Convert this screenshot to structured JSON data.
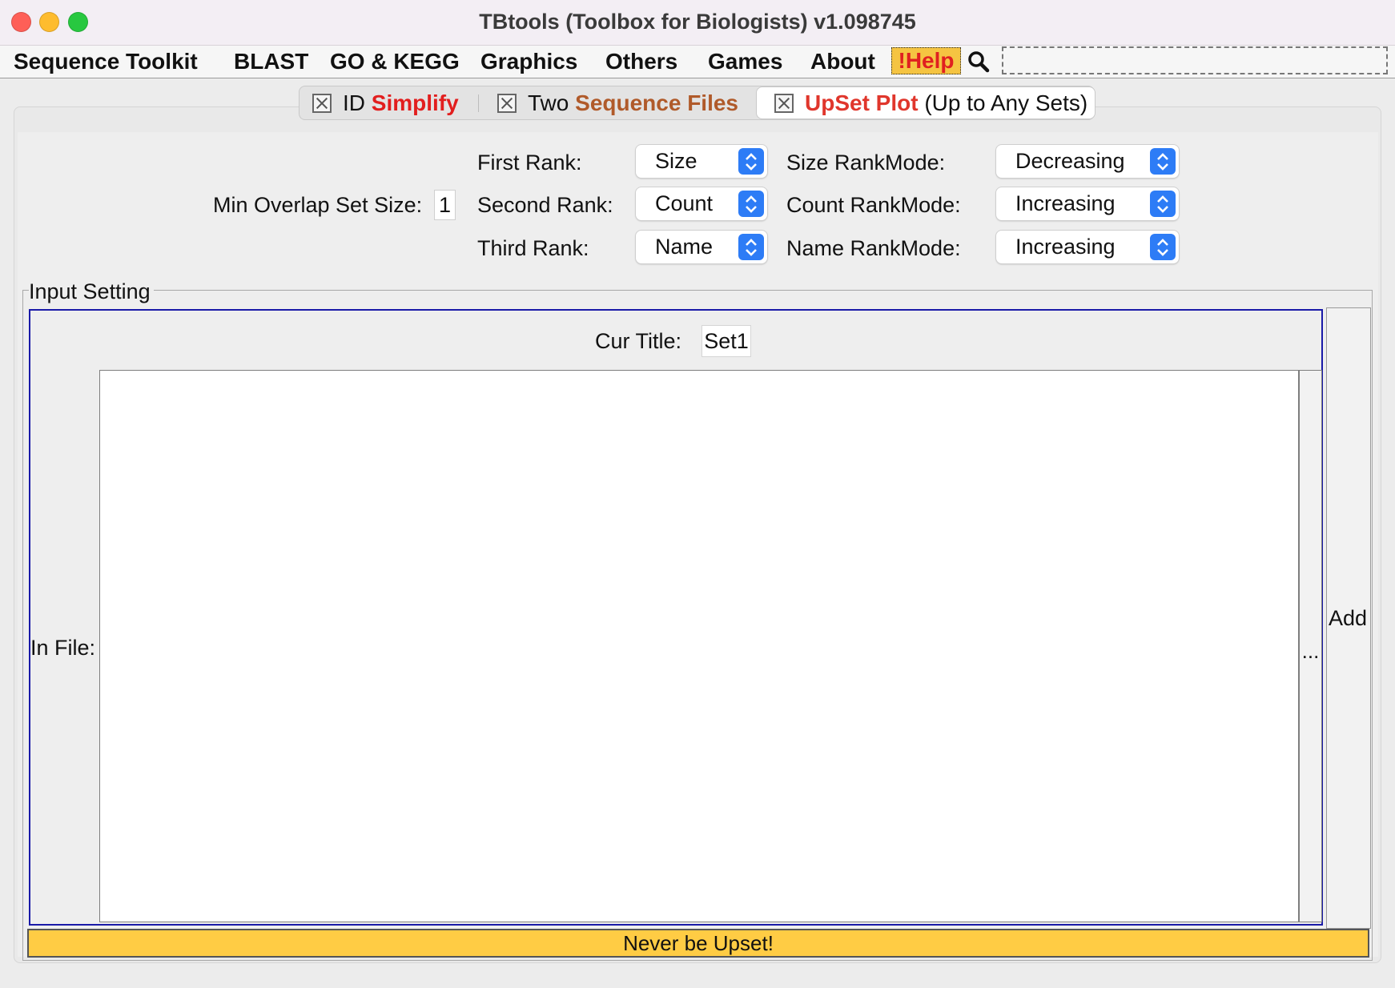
{
  "window": {
    "title": "TBtools (Toolbox for Biologists) v1.098745",
    "traffic_lights": {
      "close": "#fe5f57",
      "minimize": "#febc2e",
      "zoom": "#28c840"
    }
  },
  "menubar": {
    "items": [
      "Sequence Toolkit",
      "BLAST",
      "GO & KEGG",
      "Graphics",
      "Others",
      "Games",
      "About"
    ],
    "help_label": "!Help",
    "search_icon": "magnifier-icon",
    "search_value": ""
  },
  "tabs": [
    {
      "prefix": "ID",
      "highlight": "Simplify",
      "suffix": "",
      "highlight_color": "#e21e1e",
      "active": false
    },
    {
      "prefix": "Two",
      "highlight": "Sequence Files",
      "suffix": "",
      "highlight_color": "#b05a2a",
      "active": false
    },
    {
      "prefix": "",
      "highlight": "UpSet Plot",
      "suffix": "(Up to Any Sets)",
      "highlight_color": "#e0362c",
      "active": true
    }
  ],
  "settings": {
    "min_overlap_label": "Min Overlap Set Size:",
    "min_overlap_value": "1",
    "ranks": [
      {
        "label": "First Rank:",
        "value": "Size",
        "mode_label": "Size RankMode:",
        "mode_value": "Decreasing"
      },
      {
        "label": "Second Rank:",
        "value": "Count",
        "mode_label": "Count RankMode:",
        "mode_value": "Increasing"
      },
      {
        "label": "Third Rank:",
        "value": "Name",
        "mode_label": "Name RankMode:",
        "mode_value": "Increasing"
      }
    ]
  },
  "input_setting": {
    "group_title": "Input Setting",
    "cur_title_label": "Cur Title:",
    "cur_title_value": "Set1",
    "in_file_label": "In File:",
    "in_file_value": "",
    "browse_label": "...",
    "add_label": "Add"
  },
  "status": {
    "text": "Never be Upset!",
    "color": "#ffcc44"
  },
  "colors": {
    "accent": "#2d7cf6",
    "help_bg": "#f5c442",
    "selection_border": "#1a1aa8"
  }
}
